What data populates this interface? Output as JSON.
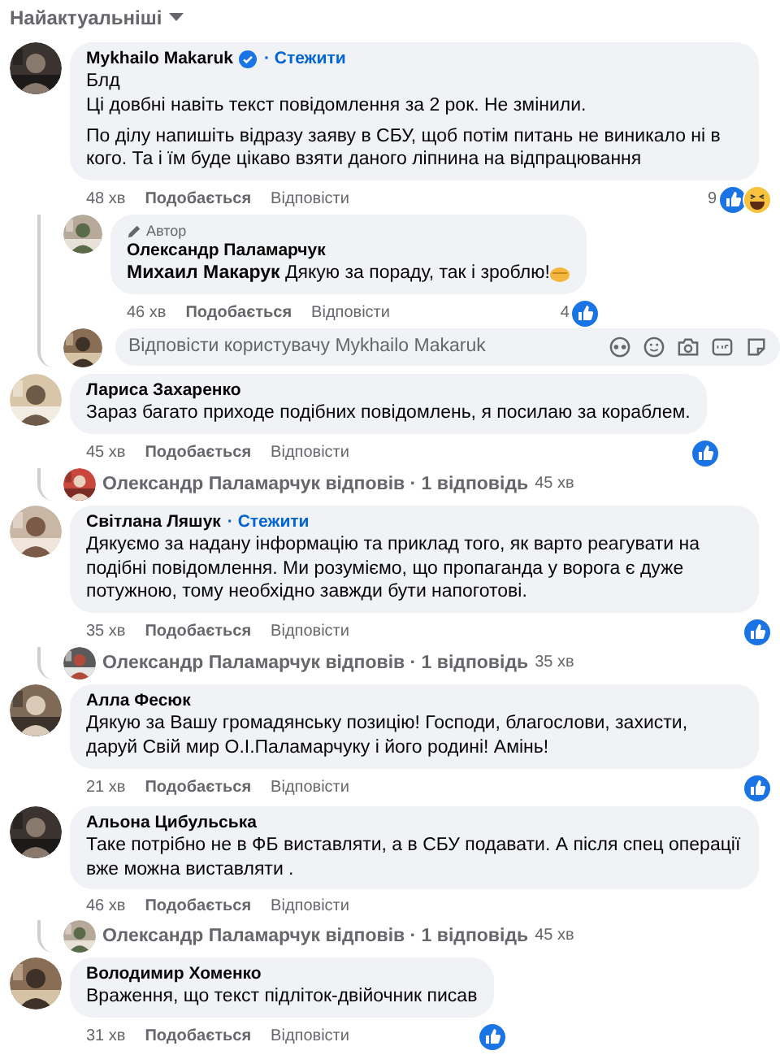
{
  "sort": {
    "label": "Найактуальніші"
  },
  "comments": [
    {
      "author": "Mykhailo Makaruk",
      "verified": true,
      "follow": "· Стежити",
      "paragraphs": [
        "Блд\nЦі довбні навіть текст повідомлення за 2 рок. Не змінили.",
        "По ділу напишіть відразу заяву в СБУ, щоб потім питань не виникало ні в кого. Та і їм буде цікаво взяти даного ліпнина на відпрацювання"
      ],
      "time": "48 хв",
      "like": "Подобається",
      "reply": "Відповісти",
      "reactions": {
        "count": "9",
        "kinds": [
          {
            "kind": "like"
          },
          {
            "kind": "haha"
          }
        ]
      },
      "replies": [
        {
          "badge": "Автор",
          "author": "Олександр Паламарчук",
          "paragraphs": [
            "**Михаил Макарук** Дякую за пораду, так і зроблю!"
          ],
          "emoji": true,
          "time": "46 хв",
          "like": "Подобається",
          "reply": "Відповісти",
          "reactions": {
            "count": "4",
            "kinds": [
              {
                "kind": "like"
              }
            ]
          }
        }
      ],
      "reply_box": {
        "placeholder": "Відповісти користувачу Mykhailo Makaruk"
      }
    },
    {
      "author": "Лариса Захаренко",
      "paragraphs": [
        "Зараз багато приходе подібних повідомлень, я посилаю за кораблем."
      ],
      "time": "45 хв",
      "like": "Подобається",
      "reply": "Відповісти",
      "reactions": {
        "kinds": [
          {
            "kind": "like"
          }
        ]
      },
      "summary": {
        "text": "Олександр Паламарчук відповів · 1 відповідь",
        "time": "45 хв"
      }
    },
    {
      "author": "Світлана Ляшук",
      "follow": "· Стежити",
      "paragraphs": [
        "Дякуємо за надану інформацію та приклад того, як варто реагувати на подібні повідомлення. Ми розуміємо, що пропаганда у ворога є дуже потужною, тому необхідно завжди бути напоготові."
      ],
      "time": "35 хв",
      "like": "Подобається",
      "reply": "Відповісти",
      "reactions": {
        "kinds": [
          {
            "kind": "like"
          }
        ]
      },
      "summary": {
        "text": "Олександр Паламарчук відповів · 1 відповідь",
        "time": "35 хв"
      }
    },
    {
      "author": "Алла Фесюк",
      "paragraphs": [
        "Дякую за Вашу громадянську позицію! Господи, благослови, захисти, даруй Свій мир О.І.Паламарчуку і його родині! Амінь!"
      ],
      "time": "21 хв",
      "like": "Подобається",
      "reply": "Відповісти",
      "reactions": {
        "kinds": [
          {
            "kind": "like"
          }
        ]
      }
    },
    {
      "author": "Альона Цибульська",
      "paragraphs": [
        "Таке потрібно не в ФБ виставляти, а в СБУ подавати. А після спец операції вже можна виставляти ."
      ],
      "time": "46 хв",
      "like": "Подобається",
      "reply": "Відповісти",
      "summary": {
        "text": "Олександр Паламарчук відповів · 1 відповідь",
        "time": "45 хв"
      }
    },
    {
      "author": "Володимир Хоменко",
      "paragraphs": [
        "Враження, що текст підліток-двійочник писав"
      ],
      "time": "31 хв",
      "like": "Подобається",
      "reply": "Відповісти",
      "reactions": {
        "kinds": [
          {
            "kind": "like"
          }
        ]
      }
    }
  ]
}
